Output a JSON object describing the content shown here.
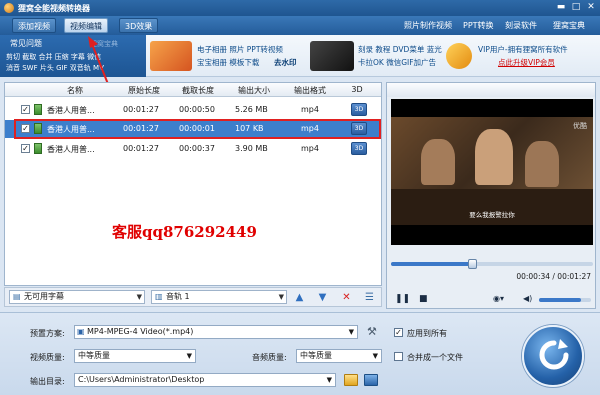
{
  "window": {
    "title": "狸窝全能视频转换器",
    "controls": [
      "▬",
      "□",
      "✕"
    ]
  },
  "toolbar": {
    "buttons": [
      "添加视频",
      "视频编辑",
      "3D效果"
    ],
    "links": [
      "照片制作视频",
      "PPT转换",
      "刻录软件",
      "狸窝宝典"
    ]
  },
  "banner": {
    "faq_tab": "常见问题",
    "guide_tab": "狸窝宝典",
    "faq_row1": "剪切 截取 合并 压缩 字幕 微信",
    "faq_row2": "消音 SWF 片头 GIF 双音轨 MV",
    "promo1_row1": "电子相册 照片 PPT转视频",
    "promo1_row2_a": "宝宝相册 模板下载",
    "promo1_row2_b": "去水印",
    "promo2_row1": "刻录 教程 DVD菜单 蓝光",
    "promo2_row2": "卡拉OK 微信GIF加广告",
    "vip_row1": "VIP用户-拥有狸窝所有软件",
    "vip_row2": "点此升级VIP会员"
  },
  "table": {
    "headers": [
      "名称",
      "原始长度",
      "截取长度",
      "输出大小",
      "输出格式",
      "3D"
    ],
    "rows": [
      {
        "name": "香港人用普...",
        "orig": "00:01:27",
        "cut": "00:00:50",
        "size": "5.26 MB",
        "format": "mp4",
        "checked": "✓",
        "td": "3D"
      },
      {
        "name": "香港人用普...",
        "orig": "00:01:27",
        "cut": "00:00:01",
        "size": "107 KB",
        "format": "mp4",
        "checked": "✓",
        "td": "3D"
      },
      {
        "name": "香港人用普...",
        "orig": "00:01:27",
        "cut": "00:00:37",
        "size": "3.90 MB",
        "format": "mp4",
        "checked": "✓",
        "td": "3D"
      }
    ]
  },
  "overlay": {
    "service_text": "客服qq876292449"
  },
  "bottombar": {
    "subtitle": "无可用字幕",
    "audio": "音轨 1"
  },
  "preview": {
    "watermark": "优酷",
    "subtitle": "要么我报警拉你",
    "time": "00:00:34 / 00:01:27",
    "progress": 0.39,
    "volume": 0.8
  },
  "settings": {
    "preset_label": "预置方案:",
    "preset_value": "MP4-MPEG-4 Video(*.mp4)",
    "video_quality_label": "视频质量:",
    "video_quality_value": "中等质量",
    "audio_quality_label": "音频质量:",
    "audio_quality_value": "中等质量",
    "output_label": "输出目录:",
    "output_value": "C:\\Users\\Administrator\\Desktop",
    "apply_all_label": "应用到所有",
    "apply_all_checked": "✓",
    "merge_label": "合并成一个文件"
  }
}
